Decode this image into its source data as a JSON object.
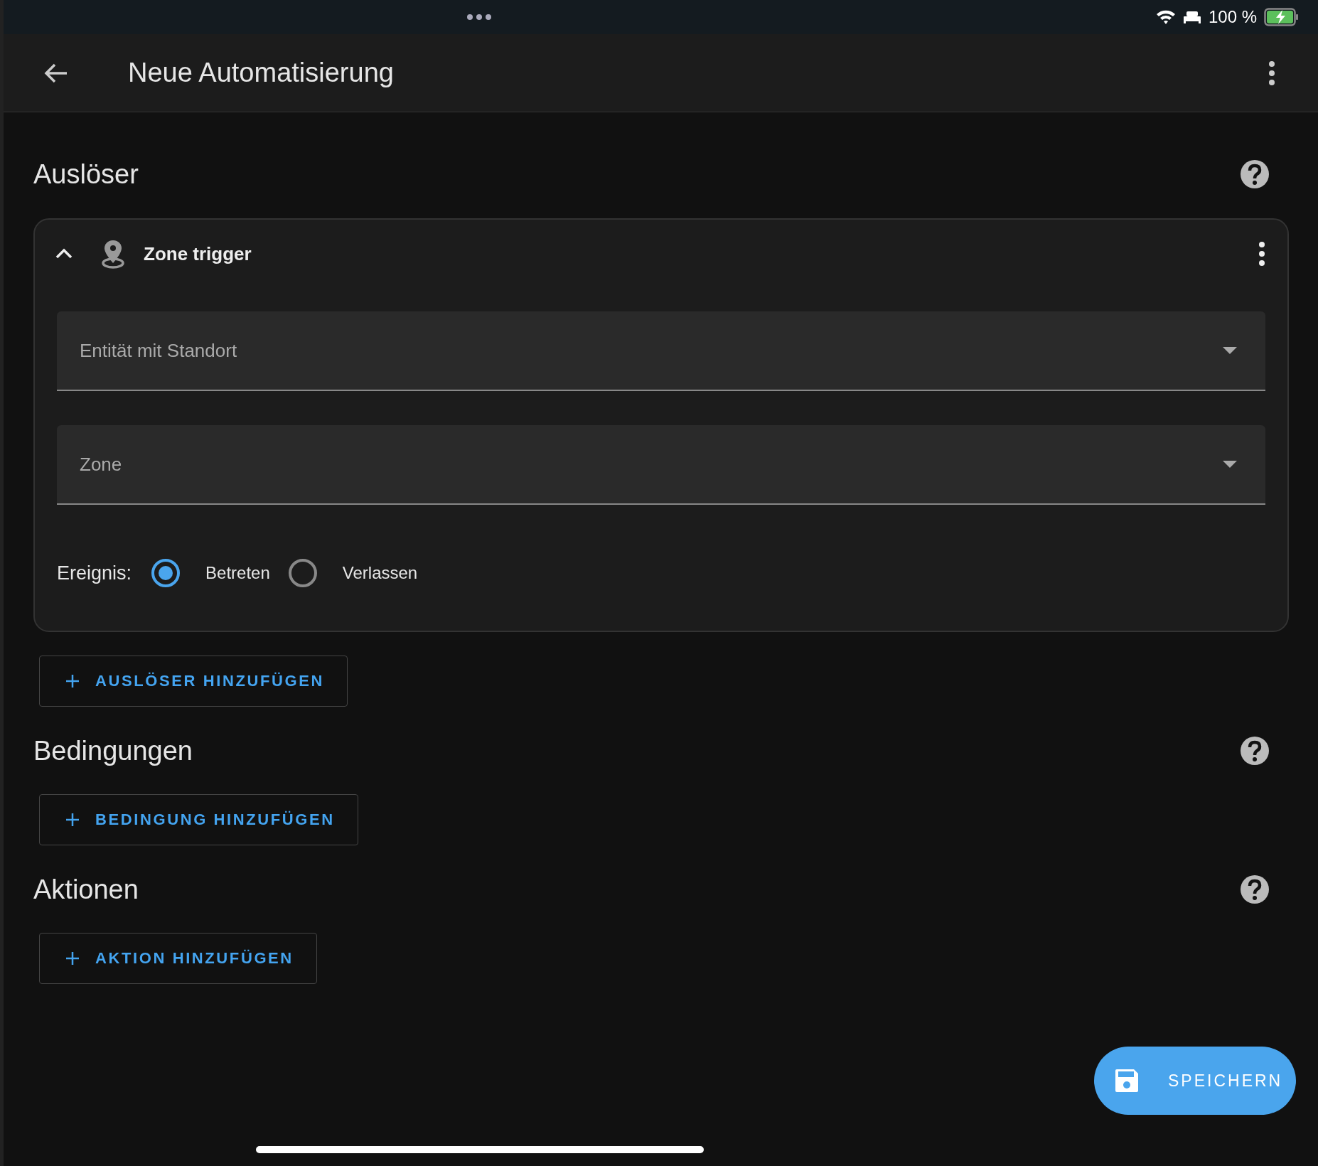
{
  "status_bar": {
    "battery": "100 %"
  },
  "header": {
    "title": "Neue Automatisierung"
  },
  "sections": [
    {
      "title": "Auslöser",
      "add_button": "AUSLÖSER HINZUFÜGEN",
      "cards": [
        {
          "title": "Zone trigger",
          "expanded": true,
          "fields": [
            {
              "placeholder": "Entität mit Standort"
            },
            {
              "placeholder": "Zone"
            }
          ],
          "event": {
            "label": "Ereignis:",
            "options": [
              {
                "label": "Betreten",
                "selected": true
              },
              {
                "label": "Verlassen",
                "selected": false
              }
            ]
          }
        }
      ]
    },
    {
      "title": "Bedingungen",
      "add_button": "BEDINGUNG HINZUFÜGEN"
    },
    {
      "title": "Aktionen",
      "add_button": "AKTION HINZUFÜGEN"
    }
  ],
  "save_button": "SPEICHERN"
}
